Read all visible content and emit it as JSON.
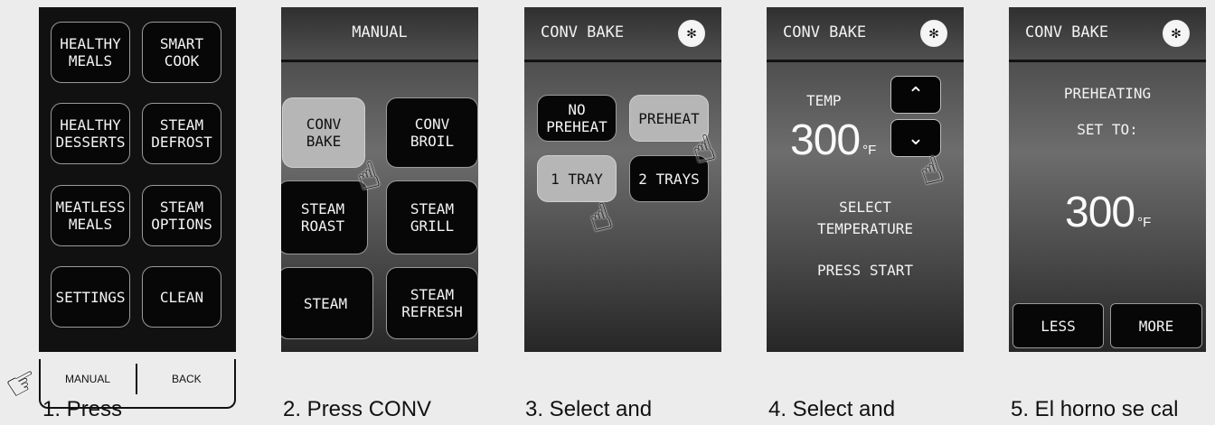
{
  "screen1": {
    "buttons": [
      "HEALTHY\nMEALS",
      "SMART\nCOOK",
      "HEALTHY\nDESSERTS",
      "STEAM\nDEFROST",
      "MEATLESS\nMEALS",
      "STEAM\nOPTIONS",
      "SETTINGS",
      "CLEAN"
    ],
    "soft_left": "MANUAL",
    "soft_right": "BACK"
  },
  "screen2": {
    "title": "MANUAL",
    "buttons": [
      "CONV\nBAKE",
      "CONV\nBROIL",
      "STEAM\nROAST",
      "STEAM\nGRILL",
      "STEAM",
      "STEAM\nREFRESH"
    ]
  },
  "screen3": {
    "title": "CONV BAKE",
    "buttons": [
      "NO\nPREHEAT",
      "PREHEAT",
      "1 TRAY",
      "2 TRAYS"
    ]
  },
  "screen4": {
    "title": "CONV BAKE",
    "temp_label": "TEMP",
    "temp_value": "300",
    "temp_unit": "°F",
    "instruction": "SELECT\nTEMPERATURE",
    "press": "PRESS START"
  },
  "screen5": {
    "title": "CONV BAKE",
    "status": "PREHEATING",
    "set_to": "SET TO:",
    "temp_value": "300",
    "temp_unit": "°F",
    "less": "LESS",
    "more": "MORE"
  },
  "captions": [
    "1. Press",
    "2. Press CONV",
    "3. Select and",
    "4. Select and",
    "5. El horno se cal"
  ]
}
